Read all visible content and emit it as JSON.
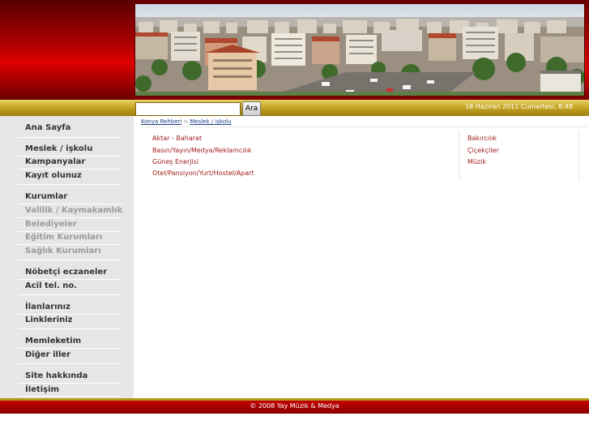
{
  "header": {
    "photo_alt": "city-panorama"
  },
  "search": {
    "value": "",
    "placeholder": "",
    "button_label": "Ara"
  },
  "date_text": "18 Haziran 2011 Cumartesi, 8:48",
  "sidebar": {
    "items": [
      {
        "label": "Ana Sayfa",
        "dim": false
      },
      {
        "label": "Meslek / işkolu",
        "dim": false
      },
      {
        "label": "Kampanyalar",
        "dim": false
      },
      {
        "label": "Kayıt olunuz",
        "dim": false
      },
      {
        "label": "Kurumlar",
        "dim": false
      },
      {
        "label": "Valilik / Kaymakamlık",
        "dim": true
      },
      {
        "label": "Belediyeler",
        "dim": true
      },
      {
        "label": "Eğitim Kurumları",
        "dim": true
      },
      {
        "label": "Sağlık Kurumları",
        "dim": true
      },
      {
        "label": "Nöbetçi eczaneler",
        "dim": false
      },
      {
        "label": "Acil tel. no.",
        "dim": false
      },
      {
        "label": "İlanlarınız",
        "dim": false
      },
      {
        "label": "Linkleriniz",
        "dim": false
      },
      {
        "label": "Memleketim",
        "dim": false
      },
      {
        "label": "Diğer iller",
        "dim": false
      },
      {
        "label": "Site hakkında",
        "dim": false
      },
      {
        "label": "İletişim",
        "dim": false
      }
    ]
  },
  "breadcrumb": {
    "root": "Konya Rehberi",
    "separator": ">",
    "current": "Meslek / işkolu"
  },
  "categories": {
    "left": [
      "Aktar - Baharat",
      "Basın/Yayın/Medya/Reklamcılık",
      "Güneş Enerjisi",
      "Otel/Pansiyon/Yurt/Hostel/Apart"
    ],
    "right": [
      "Bakırcılık",
      "Çiçekçiler",
      "Müzik"
    ]
  },
  "footer": {
    "text": "© 2008 Yay Müzik & Medya"
  },
  "colors": {
    "brand_red": "#b00000",
    "gold": "#c8a826",
    "link_red": "#a11c1c",
    "breadcrumb_blue": "#1a3f80"
  }
}
